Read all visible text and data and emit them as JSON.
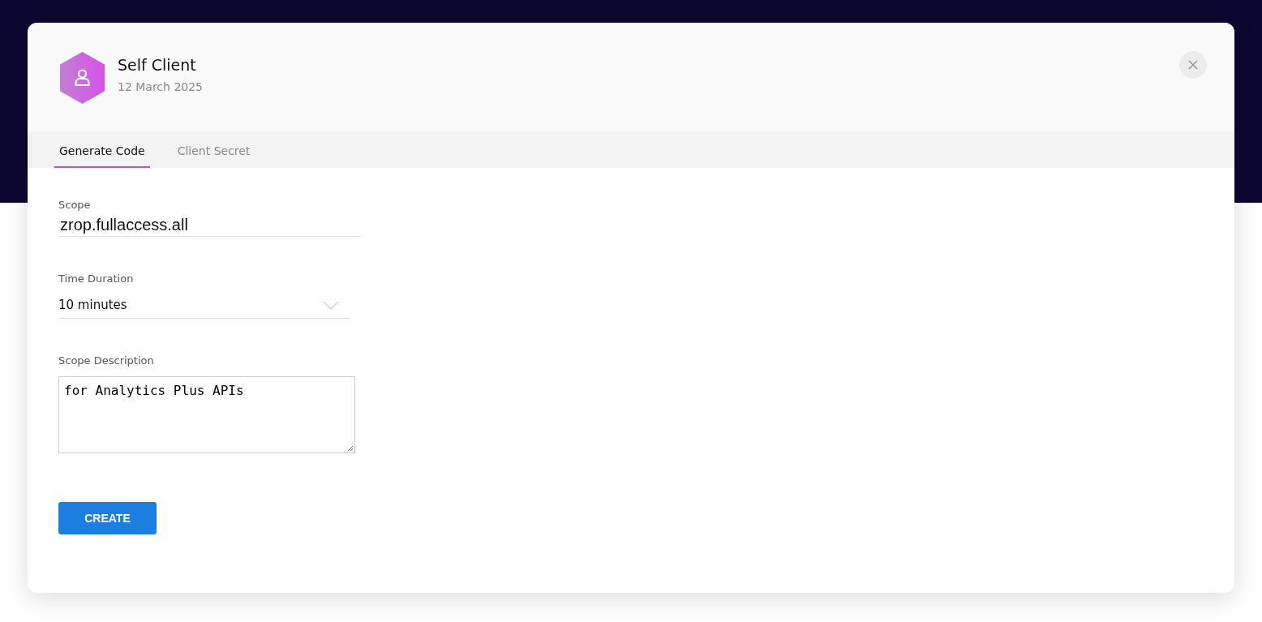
{
  "dialog": {
    "title": "Self Client",
    "date": "12 March 2025"
  },
  "tabs": [
    {
      "label": "Generate Code",
      "selected": true
    },
    {
      "label": "Client Secret",
      "selected": false
    }
  ],
  "form": {
    "scope": {
      "label": "Scope",
      "value": "zrop.fullaccess.all"
    },
    "duration": {
      "label": "Time Duration",
      "value": "10 minutes"
    },
    "description": {
      "label": "Scope Description",
      "value": "for Analytics Plus APIs"
    }
  },
  "buttons": [
    "CREATE"
  ]
}
